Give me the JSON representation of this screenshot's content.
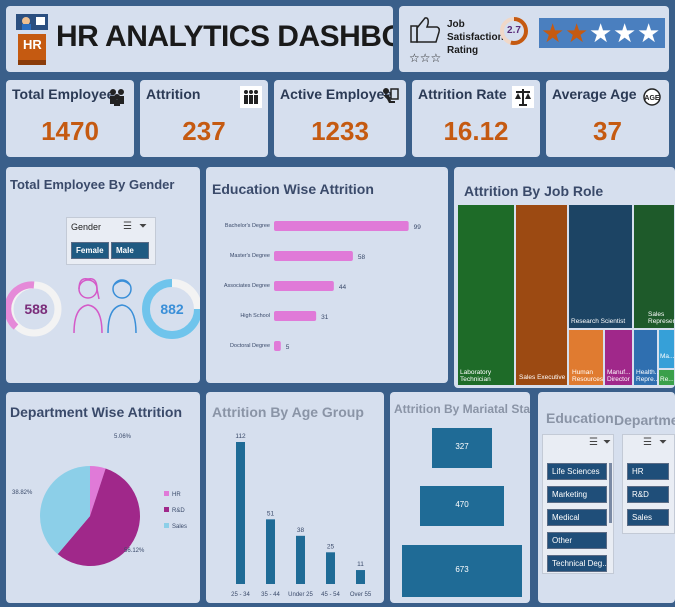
{
  "header": {
    "title": "HR ANALYTICS DASHBOARD",
    "logo_text": "HR",
    "job_satisfaction_label_line1": "Job",
    "job_satisfaction_label_line2": "Satisfaction",
    "job_satisfaction_label_line3": "Rating",
    "job_satisfaction_value": "2.7",
    "star_rating": 2.7,
    "stars_total": 5
  },
  "kpis": [
    {
      "label": "Total Employee",
      "value": "1470",
      "icon": "people-group-icon"
    },
    {
      "label": "Attrition",
      "value": "237",
      "icon": "people-leaving-icon"
    },
    {
      "label": "Active Employee",
      "value": "1233",
      "icon": "person-at-desk-icon"
    },
    {
      "label": "Attrition Rate",
      "value": "16.12",
      "icon": "scales-icon"
    },
    {
      "label": "Average Age",
      "value": "37",
      "icon": "age-icon"
    }
  ],
  "gender": {
    "title": "Total Employee By Gender",
    "slicer_title": "Gender",
    "options": [
      "Female",
      "Male"
    ],
    "female_value": "588",
    "male_value": "882"
  },
  "education_attrition": {
    "title": "Education Wise Attrition"
  },
  "job_role": {
    "title": "Attrition By Job Role",
    "roles": [
      {
        "label": "Laboratory Technician",
        "color": "#1e6b28"
      },
      {
        "label": "Sales Executive",
        "color": "#9c4a12"
      },
      {
        "label": "Research Scientist",
        "color": "#1f4e79"
      },
      {
        "label": "Sales Representative",
        "color": "#1e5a2a"
      },
      {
        "label": "Human Resources",
        "color": "#e07b30"
      },
      {
        "label": "Manuf... Director",
        "color": "#a0288a"
      },
      {
        "label": "Health... Repre...",
        "color": "#2f6fb0"
      },
      {
        "label": "Ma...",
        "color": "#36a0d8"
      },
      {
        "label": "Re...",
        "color": "#3aa04a"
      }
    ]
  },
  "department_attrition": {
    "title": "Department Wise Attrition"
  },
  "age_group": {
    "title": "Attrition By Age Group"
  },
  "marital": {
    "title": "Attrition By Mariatal Status",
    "values": [
      "327",
      "470",
      "673"
    ]
  },
  "education_slicer": {
    "title": "Education",
    "items": [
      "Life Sciences",
      "Marketing",
      "Medical",
      "Other",
      "Technical Deg..."
    ]
  },
  "department_slicer": {
    "title": "Department",
    "items": [
      "HR",
      "R&D",
      "Sales"
    ]
  },
  "chart_data": [
    {
      "type": "bar",
      "orientation": "horizontal",
      "title": "Education Wise Attrition",
      "categories": [
        "Bachelor's Degree",
        "Master's Degree",
        "Associates Degree",
        "High School",
        "Doctoral Degree"
      ],
      "values": [
        99,
        58,
        44,
        31,
        5
      ],
      "color": "#e07ad8"
    },
    {
      "type": "pie",
      "title": "Department Wise Attrition",
      "categories": [
        "HR",
        "R&D",
        "Sales"
      ],
      "values": [
        5.06,
        56.12,
        38.82
      ],
      "labels": [
        "5.06%",
        "56.12%",
        "38.82%"
      ],
      "colors": [
        "#e07ad8",
        "#a0288a",
        "#8ccfe8"
      ],
      "legend_position": "right"
    },
    {
      "type": "bar",
      "title": "Attrition By Age Group",
      "categories": [
        "25 - 34",
        "35 - 44",
        "Under 25",
        "45 - 54",
        "Over 55"
      ],
      "values": [
        112,
        51,
        38,
        25,
        11
      ],
      "color": "#1f6b96"
    }
  ]
}
